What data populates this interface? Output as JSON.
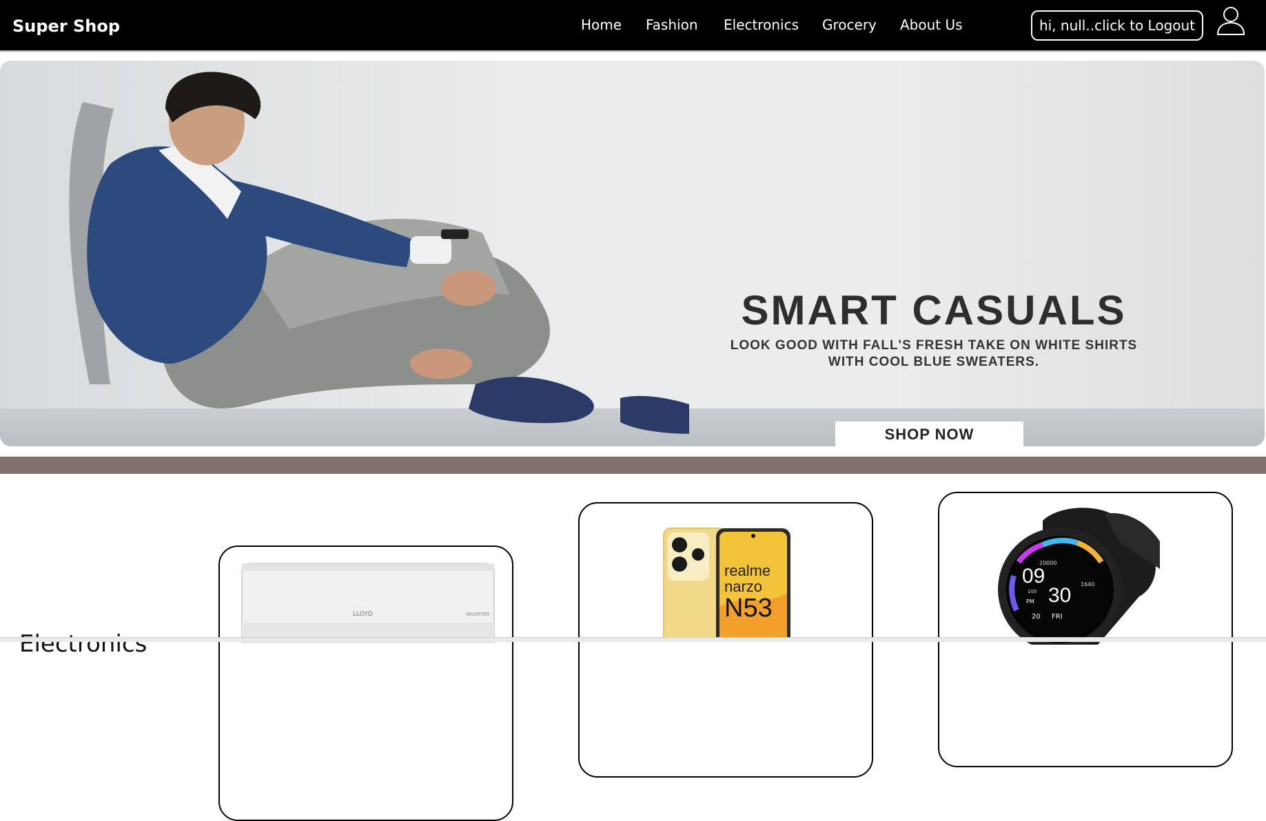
{
  "header": {
    "brand": "Super Shop",
    "nav": [
      {
        "label": "Home"
      },
      {
        "label": "Fashion"
      },
      {
        "label": "Electronics"
      },
      {
        "label": "Grocery"
      },
      {
        "label": "About Us"
      }
    ],
    "logout_label": "hi, null..click to Logout",
    "user_icon": "user-icon"
  },
  "hero": {
    "title": "SMART CASUALS",
    "subtitle_line1": "LOOK GOOD WITH FALL'S FRESH TAKE ON WHITE SHIRTS",
    "subtitle_line2": "WITH COOL BLUE SWEATERS.",
    "button_label": "SHOP NOW"
  },
  "section": {
    "heading": "Electronics"
  },
  "products": [
    {
      "name": "air-conditioner",
      "brand_mark": "LLOYD",
      "tag": "INVERTER"
    },
    {
      "name": "smartphone",
      "brand_mark": "realme narzo N53",
      "model_line1": "realme",
      "model_line2": "narzo",
      "model_line3": "N53"
    },
    {
      "name": "smartwatch",
      "time_hour": "09",
      "time_min": "30",
      "am_pm": "PM",
      "date": "20",
      "day": "FRI",
      "steps": "20000",
      "side_value": "1640",
      "left_value": "100"
    }
  ],
  "colors": {
    "header_bg": "#000000",
    "band": "#817270",
    "hero_text": "#2e2e2e"
  }
}
